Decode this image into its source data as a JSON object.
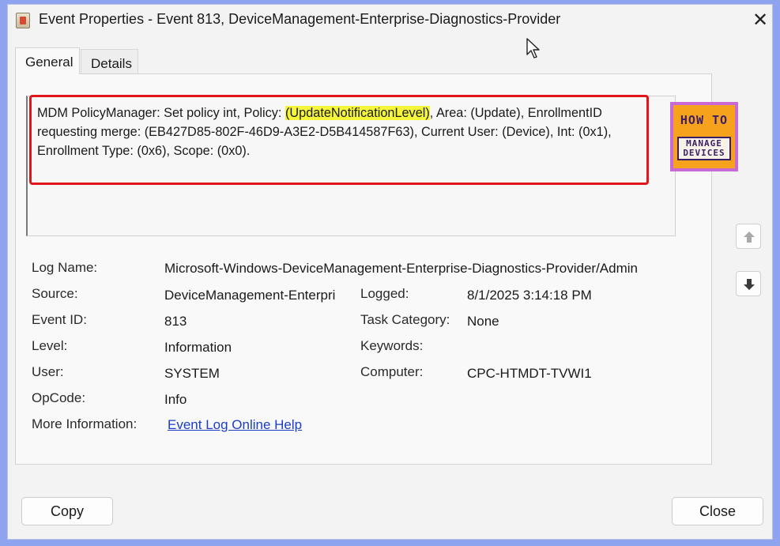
{
  "window": {
    "title": "Event Properties - Event 813, DeviceManagement-Enterprise-Diagnostics-Provider",
    "close_glyph": "✕"
  },
  "tabs": [
    {
      "label": "General",
      "active": true
    },
    {
      "label": "Details",
      "active": false
    }
  ],
  "description": {
    "part1": "MDM PolicyManager: Set policy int, Policy: ",
    "highlight": "(UpdateNotificationLevel)",
    "part2": ", Area: (Update), EnrollmentID requesting merge: (EB427D85-802F-46D9-A3E2-D5B414587F63), Current User: (Device), Int: (0x1), Enrollment Type: (0x6), Scope: (0x0)."
  },
  "logo": {
    "top_text": "HOW TO",
    "bottom_line1": "MANAGE",
    "bottom_line2": "DEVICES"
  },
  "fields": {
    "log_name": {
      "label": "Log Name:",
      "value": "Microsoft-Windows-DeviceManagement-Enterprise-Diagnostics-Provider/Admin"
    },
    "source": {
      "label": "Source:",
      "value": "DeviceManagement-Enterpri"
    },
    "logged": {
      "label": "Logged:",
      "value": "8/1/2025 3:14:18 PM"
    },
    "event_id": {
      "label": "Event ID:",
      "value": "813"
    },
    "task_category": {
      "label": "Task Category:",
      "value": "None"
    },
    "level": {
      "label": "Level:",
      "value": "Information"
    },
    "keywords": {
      "label": "Keywords:",
      "value": ""
    },
    "user": {
      "label": "User:",
      "value": "SYSTEM"
    },
    "computer": {
      "label": "Computer:",
      "value": "CPC-HTMDT-TVWI1"
    },
    "opcode": {
      "label": "OpCode:",
      "value": "Info"
    },
    "more_info": {
      "label": "More Information:",
      "link": "Event Log Online Help"
    }
  },
  "buttons": {
    "copy": "Copy",
    "close": "Close"
  },
  "colors": {
    "highlight": "#f5f53a",
    "annotation_box": "#e0161c",
    "link": "#1b3ec4"
  }
}
